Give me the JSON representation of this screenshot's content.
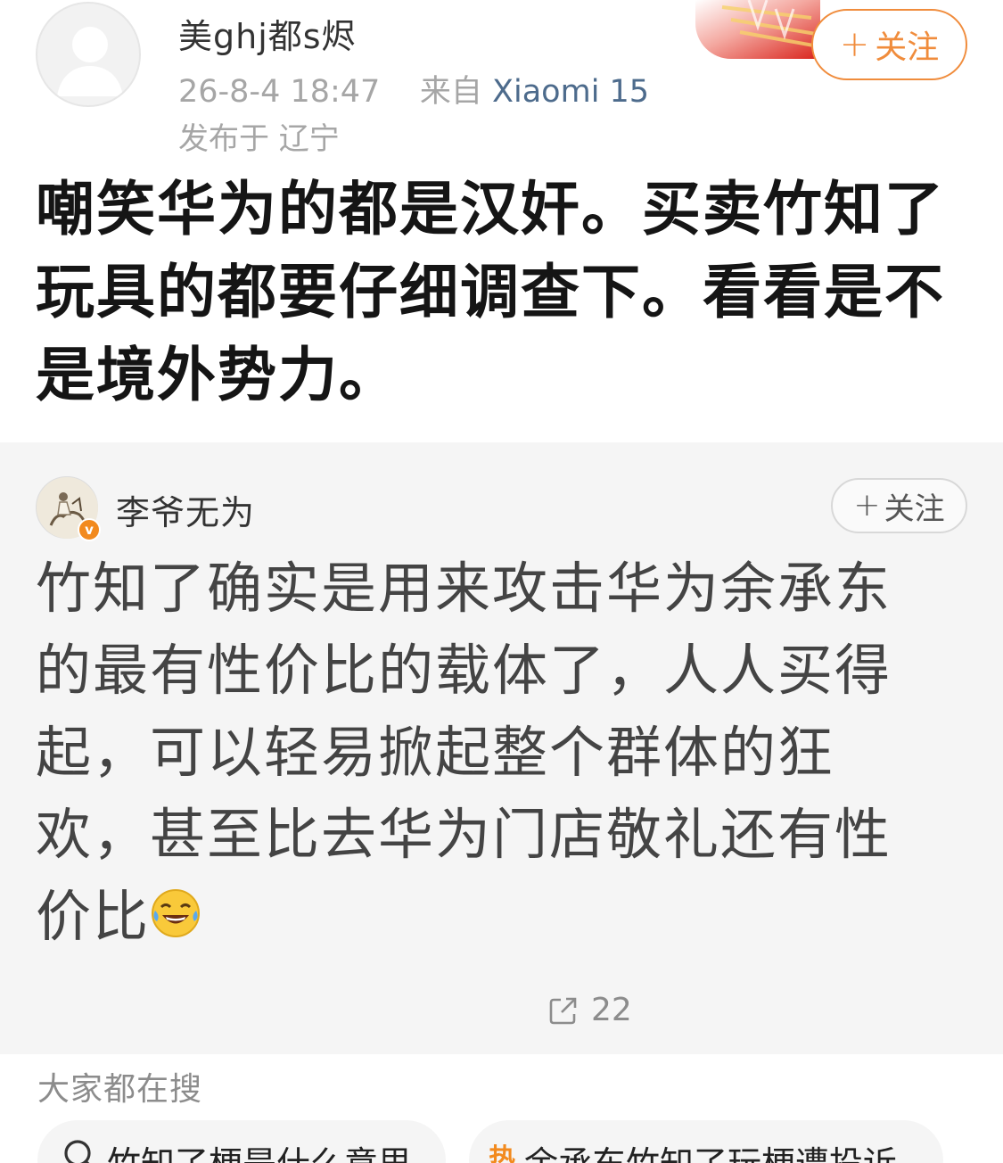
{
  "author": {
    "name": "美ghj都s烬",
    "timestamp": "26-8-4 18:47",
    "source_prefix": "来自",
    "device": "Xiaomi 15",
    "location": "发布于 辽宁",
    "follow_label": "关注"
  },
  "post": {
    "text": "嘲笑华为的都是汉奸。买卖竹知了玩具的都要仔细调查下。看看是不是境外势力。"
  },
  "repost": {
    "author_name": "李爷无为",
    "badge": "v",
    "follow_label": "关注",
    "text": "竹知了确实是用来攻击华为余承东的最有性价比的载体了，人人买得起，可以轻易掀起整个群体的狂欢，甚至比去华为门店敬礼还有性价比",
    "emoji": "laughing-tears-emoji",
    "share_count": "22"
  },
  "search": {
    "title": "大家都在搜",
    "items": [
      {
        "label": "竹知了梗是什么意思",
        "icon": "search-icon"
      },
      {
        "label": "余承东竹知了玩梗遭投诉",
        "icon": "hot-icon",
        "icon_text": "热"
      }
    ]
  },
  "colors": {
    "accent": "#f08c3c",
    "device_link": "#4d6b8c",
    "repost_bg": "#f5f5f5"
  }
}
